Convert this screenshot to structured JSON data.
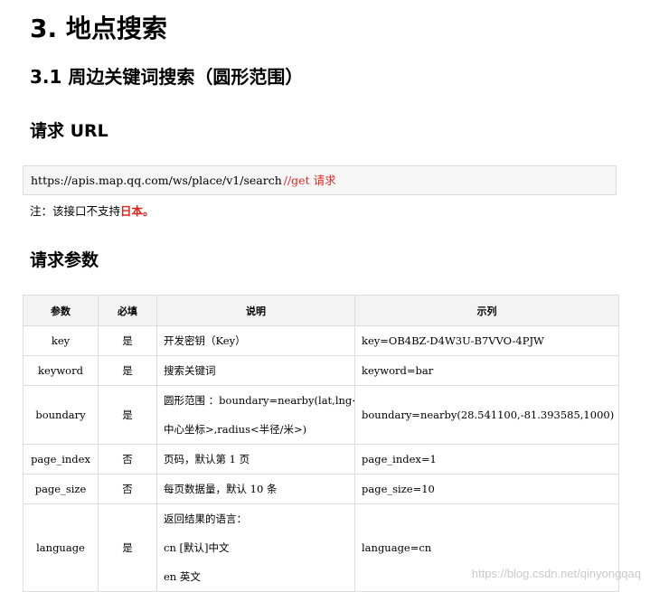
{
  "heading": "3. 地点搜索",
  "subheading": "3.1 周边关键词搜索（圆形范围）",
  "request_url_section": {
    "title": "请求 URL",
    "url": "https://apis.map.qq.com/ws/place/v1/search",
    "comment": "//get 请求"
  },
  "note": {
    "prefix": "注：该接口不支持",
    "highlight": "日本。"
  },
  "request_params_section": {
    "title": "请求参数"
  },
  "table": {
    "headers": [
      "参数",
      "必填",
      "说明",
      "示列"
    ],
    "rows": [
      {
        "param": "key",
        "required": "是",
        "desc": [
          "开发密钥（Key）"
        ],
        "example": "key=OB4BZ-D4W3U-B7VVO-4PJW"
      },
      {
        "param": "keyword",
        "required": "是",
        "desc": [
          "搜索关键词"
        ],
        "example": "keyword=bar"
      },
      {
        "param": "boundary",
        "required": "是",
        "desc": [
          "圆形范围 ：boundary=nearby(lat,lng<",
          "中心坐标>,radius<半径/米>)"
        ],
        "example": "boundary=nearby(28.541100,-81.393585,1000)"
      },
      {
        "param": "page_index",
        "required": "否",
        "desc": [
          "页码，默认第 1 页"
        ],
        "example": "page_index=1"
      },
      {
        "param": "page_size",
        "required": "否",
        "desc": [
          "每页数据量，默认 10 条"
        ],
        "example": "page_size=10"
      },
      {
        "param": "language",
        "required": "是",
        "desc": [
          "返回结果的语言：",
          "cn [默认]中文",
          "en 英文"
        ],
        "example": "language=cn"
      }
    ]
  },
  "watermark": "https://blog.csdn.net/qinyongqaq"
}
